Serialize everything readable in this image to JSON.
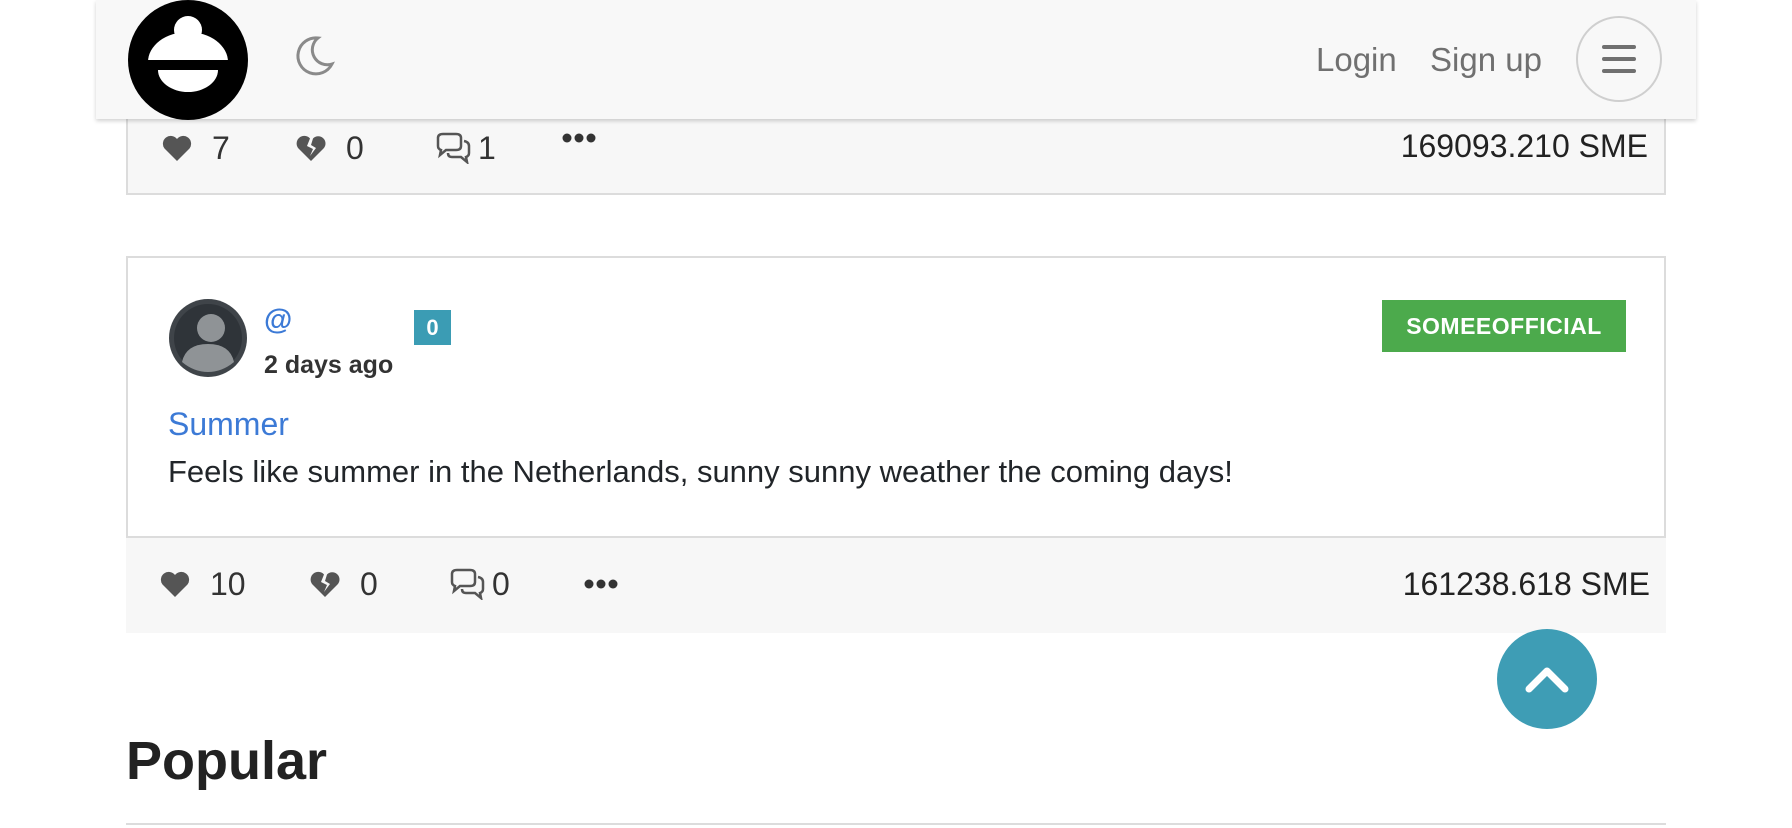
{
  "nav": {
    "login": "Login",
    "signup": "Sign up",
    "icons": {
      "logo": "site-logo",
      "theme": "moon-icon",
      "menu": "hamburger-icon"
    }
  },
  "posts": [
    {
      "likes": "7",
      "dislikes": "0",
      "comments": "1",
      "reward": "169093.210 SME"
    },
    {
      "username": "@",
      "reputation": "0",
      "time": "2 days ago",
      "community": "SOMEEOFFICIAL",
      "title": "Summer",
      "body": "Feels like summer in the Netherlands, sunny sunny weather the coming days!",
      "likes": "10",
      "dislikes": "0",
      "comments": "0",
      "reward": "161238.618 SME"
    }
  ],
  "section": {
    "title": "Popular"
  },
  "colors": {
    "link": "#3c7ad6",
    "community_badge": "#4caa4c",
    "rep_badge": "#3b9cb4",
    "scroll_top": "#3e9db5"
  }
}
